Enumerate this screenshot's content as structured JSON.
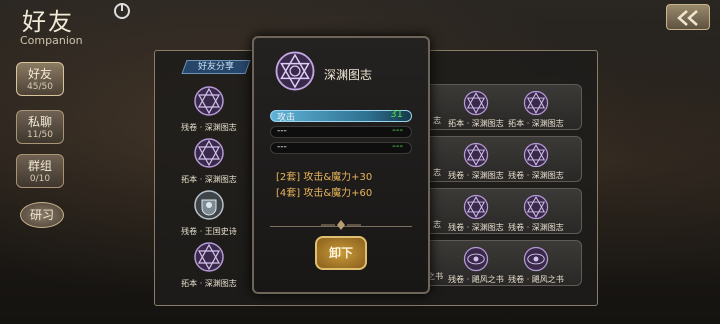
{
  "header": {
    "title": "好友",
    "subtitle": "Companion"
  },
  "nav": [
    {
      "label": "好友",
      "count": "45/50",
      "active": true
    },
    {
      "label": "私聊",
      "count": "11/50",
      "active": false
    },
    {
      "label": "群组",
      "count": "0/10",
      "active": false
    }
  ],
  "research_label": "研习",
  "share_tab": "好友分享",
  "left_column": [
    {
      "label": "残卷 · 深渊图志",
      "icon": "abyss-sigil-icon"
    },
    {
      "label": "拓本 · 深渊图志",
      "icon": "abyss-sigil-icon"
    },
    {
      "label": "残卷 · 王国史诗",
      "icon": "kingdom-crest-icon"
    },
    {
      "label": "拓本 · 深渊图志",
      "icon": "abyss-sigil-icon"
    }
  ],
  "cards": [
    {
      "edge": "志",
      "items": [
        "拓本 · 深渊图志",
        "拓本 · 深渊图志"
      ]
    },
    {
      "edge": "志",
      "items": [
        "残卷 · 深渊图志",
        "残卷 · 深渊图志"
      ]
    },
    {
      "edge": "志",
      "items": [
        "残卷 · 深渊图志",
        "残卷 · 深渊图志"
      ]
    },
    {
      "edge": "之书",
      "items": [
        "残卷 · 飓风之书",
        "残卷 · 飓风之书"
      ]
    }
  ],
  "detail": {
    "title": "深渊图志",
    "stats": [
      {
        "name": "攻击",
        "value": "31"
      },
      {
        "name": "---",
        "value": "---"
      },
      {
        "name": "---",
        "value": "---"
      }
    ],
    "set_bonuses": [
      "[2套] 攻击&魔力+30",
      "[4套] 攻击&魔力+60"
    ],
    "unequip_label": "卸下"
  }
}
